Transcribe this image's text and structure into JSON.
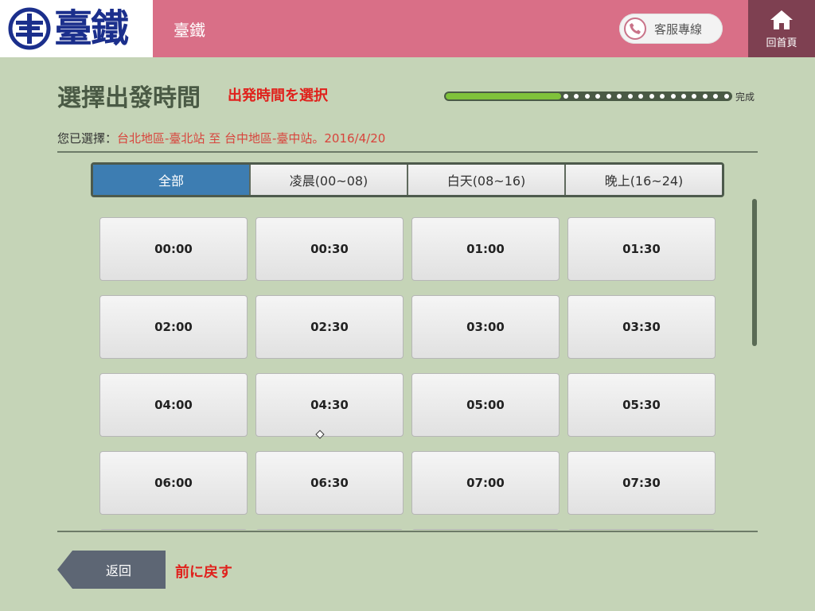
{
  "header": {
    "logo_text": "臺鐵",
    "title": "臺鐵",
    "hotline_label": "客服專線",
    "home_label": "回首頁"
  },
  "page": {
    "title": "選擇出發時間",
    "title_jp": "出発時間を選択",
    "progress_end_label": "完成",
    "progress": 0.4,
    "selection_label": "您已選擇：",
    "selection_value": "台北地區-臺北站 至 台中地區-臺中站。2016/4/20"
  },
  "tabs": [
    {
      "label": "全部",
      "active": true
    },
    {
      "label": "凌晨(00~08)",
      "active": false
    },
    {
      "label": "白天(08~16)",
      "active": false
    },
    {
      "label": "晚上(16~24)",
      "active": false
    }
  ],
  "times": [
    "00:00",
    "00:30",
    "01:00",
    "01:30",
    "02:00",
    "02:30",
    "03:00",
    "03:30",
    "04:00",
    "04:30",
    "05:00",
    "05:30",
    "06:00",
    "06:30",
    "07:00",
    "07:30"
  ],
  "footer": {
    "back_label": "返回",
    "back_jp": "前に戻す"
  },
  "colors": {
    "header_bg": "#d96f87",
    "home_bg": "#7e4051",
    "page_bg": "#c5d4b7",
    "tab_active": "#3d7db2",
    "accent_red": "#e0211c",
    "progress_fill": "#7fc23a"
  },
  "icons": {
    "logo": "railway-logo-icon",
    "hotline": "phone-icon",
    "home": "home-icon"
  }
}
